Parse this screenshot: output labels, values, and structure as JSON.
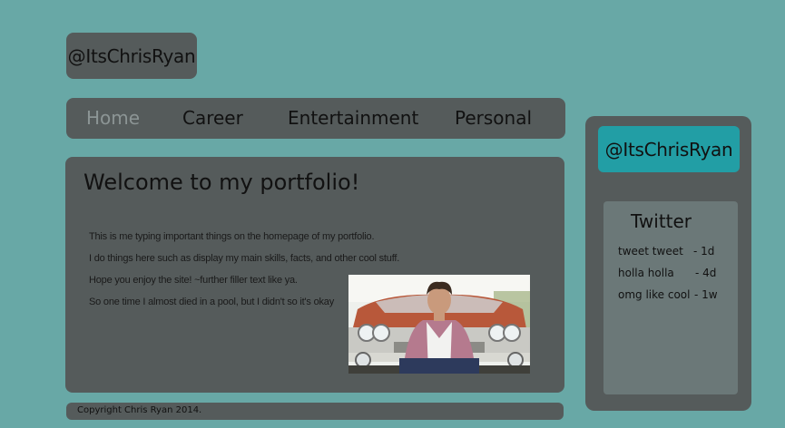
{
  "header": {
    "handle": "@ItsChrisRyan"
  },
  "nav": {
    "items": [
      {
        "label": "Home",
        "active": true
      },
      {
        "label": "Career",
        "active": false
      },
      {
        "label": "Entertainment",
        "active": false
      },
      {
        "label": "Personal",
        "active": false
      }
    ]
  },
  "main": {
    "title": "Welcome to my portfolio!",
    "paragraphs": [
      "This is me typing important things on the homepage of my portfolio.",
      "I do things here such as display my main skills, facts, and other cool stuff.",
      "Hope you enjoy the site! ~further filler text like ya.",
      "So one time I almost died in a pool, but I didn't so it's okay"
    ]
  },
  "footer": {
    "copyright": "Copyright Chris Ryan 2014."
  },
  "sidebar": {
    "handle": "@ItsChrisRyan",
    "twitter": {
      "title": "Twitter",
      "tweets": [
        {
          "text": "tweet tweet",
          "age": "- 1d"
        },
        {
          "text": "holla holla",
          "age": "- 4d"
        },
        {
          "text": "omg like cool",
          "age": "- 1w"
        }
      ]
    }
  },
  "colors": {
    "background": "#68a8a6",
    "panel": "#555b5b",
    "accent": "#229ea5",
    "nav_active": "#8c9595",
    "twitter_box": "#6b7878"
  }
}
